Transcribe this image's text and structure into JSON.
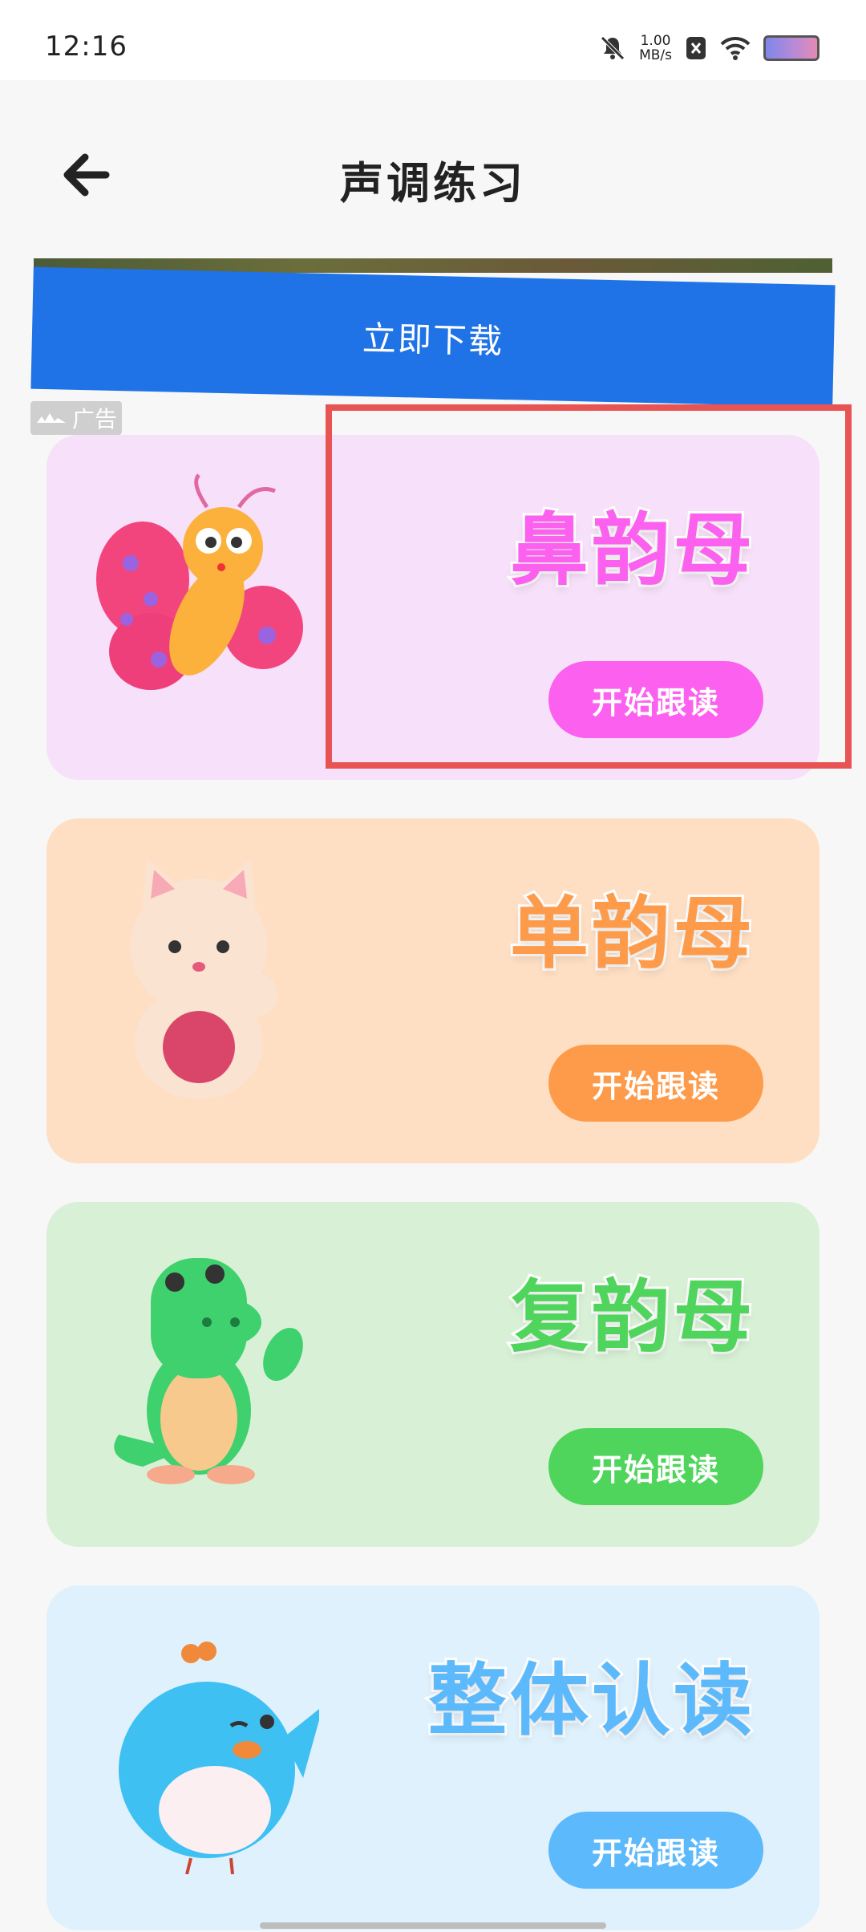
{
  "status_bar": {
    "time": "12:16",
    "net_speed_top": "1.00",
    "net_speed_bottom": "MB/s"
  },
  "header": {
    "title": "声调练习"
  },
  "ad": {
    "download_label": "立即下载",
    "badge_label": "广告"
  },
  "cards": [
    {
      "title": "鼻韵母",
      "button": "开始跟读",
      "bg": "#f7e0f9",
      "accent": "#fb61ee",
      "mascot": "butterfly"
    },
    {
      "title": "单韵母",
      "button": "开始跟读",
      "bg": "#ffdfc3",
      "accent": "#fe9b4a",
      "mascot": "cat"
    },
    {
      "title": "复韵母",
      "button": "开始跟读",
      "bg": "#d8f1d6",
      "accent": "#4fd45c",
      "mascot": "crocodile"
    },
    {
      "title": "整体认读",
      "button": "开始跟读",
      "bg": "#dff1fd",
      "accent": "#5bb9fc",
      "mascot": "bird"
    }
  ]
}
